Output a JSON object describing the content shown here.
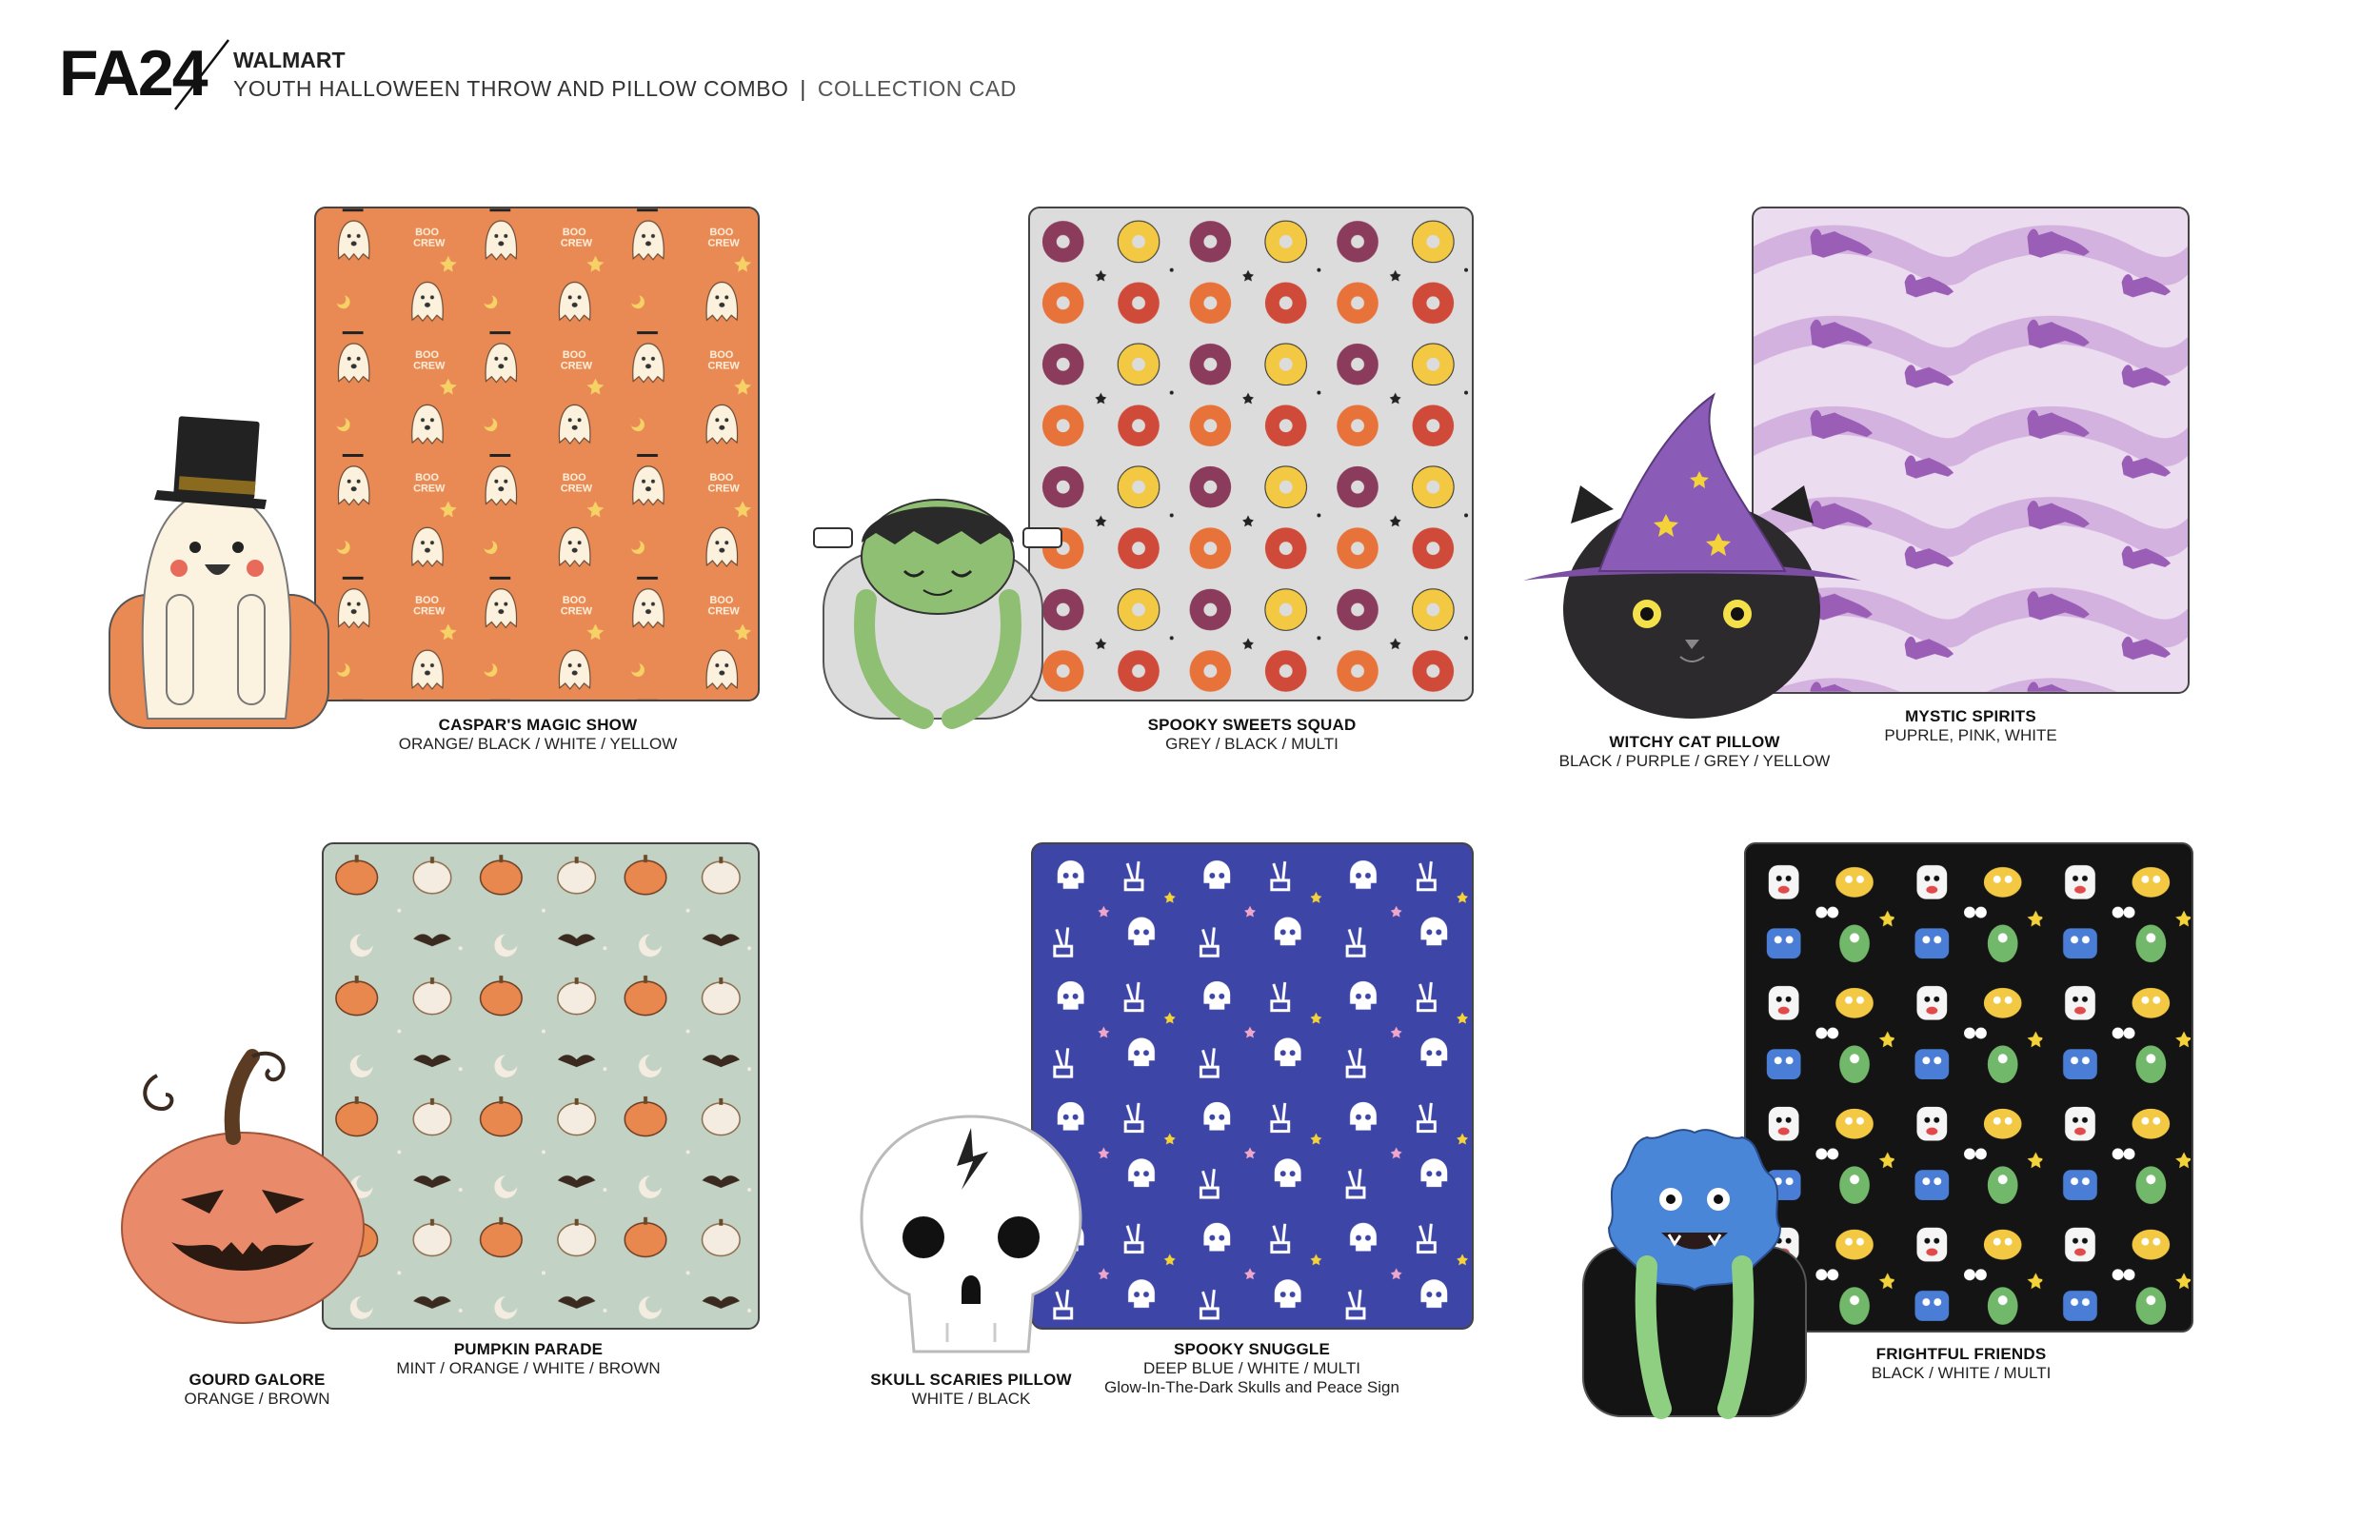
{
  "header": {
    "code": "FA24",
    "brand": "WALMART",
    "subtitle": "YOUTH HALLOWEEN THROW AND PILLOW COMBO",
    "separator": "|",
    "subtitle_right": "COLLECTION CAD"
  },
  "products": [
    {
      "throw": {
        "name": "CASPAR'S MAGIC SHOW",
        "colors": "ORANGE/ BLACK / WHITE / YELLOW",
        "background": "#e98a55",
        "motif": "ghost"
      },
      "pillow": {
        "motif": "ghost-with-top-hat"
      },
      "motif_text": "BOO CREW"
    },
    {
      "throw": {
        "name": "SPOOKY SWEETS SQUAD",
        "colors": "GREY / BLACK / MULTI",
        "background": "#dcdcdc",
        "motif": "donut"
      },
      "pillow": {
        "motif": "frankenstein-hug"
      }
    },
    {
      "throw": {
        "name": "MYSTIC SPIRITS",
        "colors": "PUPRLE, PINK, WHITE",
        "background": "#ecdcef",
        "motif": "cat"
      },
      "pillow": {
        "name": "WITCHY CAT PILLOW",
        "colors": "BLACK / PURPLE / GREY / YELLOW",
        "motif": "witch-cat"
      }
    },
    {
      "throw": {
        "name": "PUMPKIN PARADE",
        "colors": "MINT / ORANGE / WHITE / BROWN",
        "background": "#c2d3c6",
        "motif": "pumpkin"
      },
      "pillow": {
        "name": "GOURD GALORE",
        "colors": "ORANGE / BROWN",
        "motif": "jack-o-lantern"
      }
    },
    {
      "throw": {
        "name": "SPOOKY SNUGGLE",
        "colors": "DEEP BLUE / WHITE / MULTI",
        "extra": "Glow-In-The-Dark Skulls and Peace Sign",
        "background": "#3d45a6",
        "motif": "skull"
      },
      "pillow": {
        "name": "SKULL SCARIES PILLOW",
        "colors": "WHITE / BLACK",
        "motif": "skull"
      }
    },
    {
      "throw": {
        "name": "FRIGHTFUL FRIENDS",
        "colors": "BLACK / WHITE / MULTI",
        "background": "#141414",
        "motif": "monster"
      },
      "pillow": {
        "motif": "blue-monster-hug"
      }
    }
  ],
  "colors": {
    "orange": "#e98a55",
    "grey": "#dcdcdc",
    "lilac": "#ecdcef",
    "mint": "#c2d3c6",
    "deep_blue": "#3d45a6",
    "black": "#141414"
  }
}
